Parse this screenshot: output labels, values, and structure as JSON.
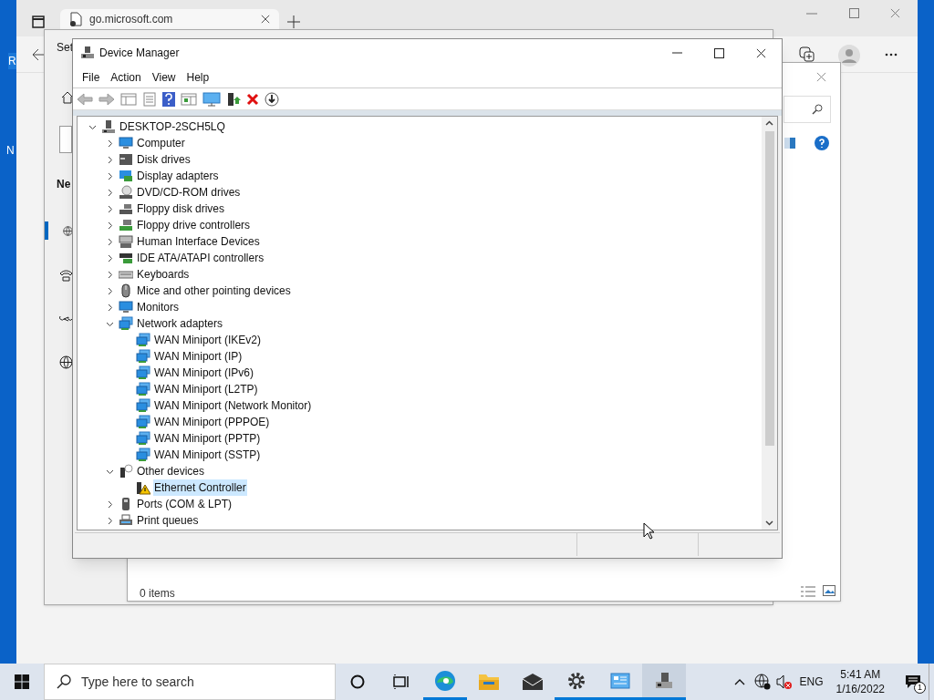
{
  "desktop": {
    "icon_labels": [
      "R",
      "N"
    ]
  },
  "browser": {
    "tab": {
      "title": "go.microsoft.com"
    }
  },
  "settings": {
    "title": "Set",
    "heading": "Ne",
    "nav": [
      {
        "selected": true
      },
      {
        "selected": false
      },
      {
        "selected": false
      },
      {
        "selected": false
      }
    ]
  },
  "dialog": {
    "status": "0 items"
  },
  "device_manager": {
    "title": "Device Manager",
    "menu": [
      "File",
      "Action",
      "View",
      "Help"
    ],
    "tree": {
      "label": "DESKTOP-2SCH5LQ",
      "expanded": true,
      "selected": false,
      "children": [
        {
          "label": "Computer",
          "expanded": false,
          "selected": false
        },
        {
          "label": "Disk drives",
          "expanded": false,
          "selected": false
        },
        {
          "label": "Display adapters",
          "expanded": false,
          "selected": false
        },
        {
          "label": "DVD/CD-ROM drives",
          "expanded": false,
          "selected": false
        },
        {
          "label": "Floppy disk drives",
          "expanded": false,
          "selected": false
        },
        {
          "label": "Floppy drive controllers",
          "expanded": false,
          "selected": false
        },
        {
          "label": "Human Interface Devices",
          "expanded": false,
          "selected": false
        },
        {
          "label": "IDE ATA/ATAPI controllers",
          "expanded": false,
          "selected": false
        },
        {
          "label": "Keyboards",
          "expanded": false,
          "selected": false
        },
        {
          "label": "Mice and other pointing devices",
          "expanded": false,
          "selected": false
        },
        {
          "label": "Monitors",
          "expanded": false,
          "selected": false
        },
        {
          "label": "Network adapters",
          "expanded": true,
          "selected": false,
          "children": [
            {
              "label": "WAN Miniport (IKEv2)",
              "selected": false
            },
            {
              "label": "WAN Miniport (IP)",
              "selected": false
            },
            {
              "label": "WAN Miniport (IPv6)",
              "selected": false
            },
            {
              "label": "WAN Miniport (L2TP)",
              "selected": false
            },
            {
              "label": "WAN Miniport (Network Monitor)",
              "selected": false
            },
            {
              "label": "WAN Miniport (PPPOE)",
              "selected": false
            },
            {
              "label": "WAN Miniport (PPTP)",
              "selected": false
            },
            {
              "label": "WAN Miniport (SSTP)",
              "selected": false
            }
          ]
        },
        {
          "label": "Other devices",
          "expanded": true,
          "selected": false,
          "children": [
            {
              "label": "Ethernet Controller",
              "selected": true
            }
          ]
        },
        {
          "label": "Ports (COM & LPT)",
          "expanded": false,
          "selected": false
        },
        {
          "label": "Print queues",
          "expanded": false,
          "selected": false
        }
      ]
    }
  },
  "taskbar": {
    "search": {
      "placeholder": "Type here to search"
    },
    "apps": [
      {
        "running": true,
        "active": false
      },
      {
        "running": false,
        "active": false
      },
      {
        "running": false,
        "active": false
      },
      {
        "running": true,
        "active": false
      },
      {
        "running": true,
        "active": false
      },
      {
        "running": true,
        "active": true
      }
    ],
    "tray": {
      "language": "ENG",
      "time": "5:41 AM",
      "date": "1/16/2022",
      "notifications": "1"
    }
  }
}
